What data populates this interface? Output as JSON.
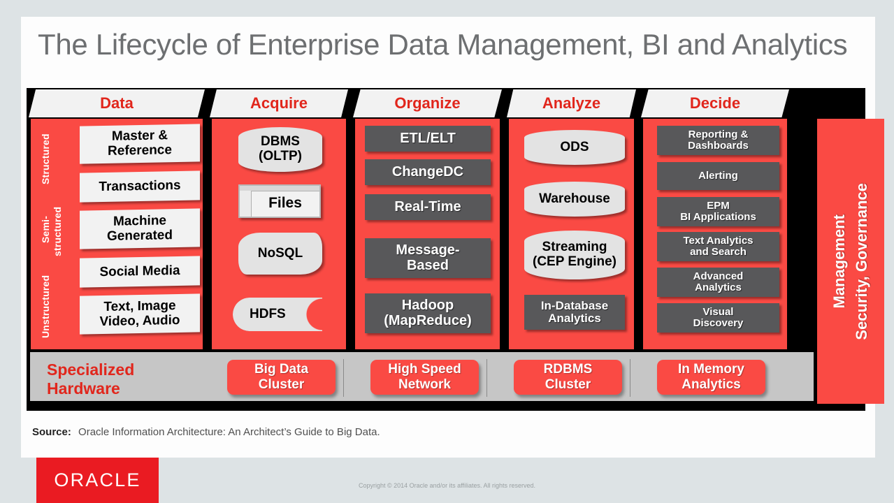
{
  "slide": {
    "title": "The Lifecycle of Enterprise Data Management, BI and Analytics",
    "source_label": "Source:",
    "source_text": "Oracle Information Architecture: An Architect’s Guide to Big Data.",
    "copyright": "Copyright © 2014 Oracle and/or its affiliates. All rights reserved.",
    "logo_text": "ORACLE"
  },
  "colors": {
    "red": "#fa4a44",
    "brand_red": "#e1261c",
    "dark_gray": "#58585a",
    "light_gray_node": "#e3e3e3",
    "white_node": "#f2f2f2",
    "hardware_band": "#c6c6c6",
    "frame": "#000000",
    "page_bg": "#dde3e5"
  },
  "columns": [
    {
      "header": "Data",
      "structure_labels": [
        "Structured",
        "Semi-\nstructured",
        "Unstructured"
      ],
      "structure_label_1": "Structured",
      "structure_label_2a": "Semi-",
      "structure_label_2b": "structured",
      "structure_label_3": "Unstructured",
      "nodes": [
        {
          "label": "Master &\nReference",
          "line1": "Master &",
          "line2": "Reference",
          "shape": "box-white"
        },
        {
          "label": "Transactions",
          "line1": "Transactions",
          "line2": "",
          "shape": "box-white"
        },
        {
          "label": "Machine\nGenerated",
          "line1": "Machine",
          "line2": "Generated",
          "shape": "box-white"
        },
        {
          "label": "Social Media",
          "line1": "Social Media",
          "line2": "",
          "shape": "box-white"
        },
        {
          "label": "Text, Image\nVideo, Audio",
          "line1": "Text, Image",
          "line2": "Video, Audio",
          "shape": "box-white"
        }
      ]
    },
    {
      "header": "Acquire",
      "nodes": [
        {
          "label": "DBMS\n(OLTP)",
          "line1": "DBMS",
          "line2": "(OLTP)",
          "shape": "cylinder"
        },
        {
          "label": "Files",
          "line1": "Files",
          "line2": "",
          "shape": "window"
        },
        {
          "label": "NoSQL",
          "line1": "NoSQL",
          "line2": "",
          "shape": "flowchart"
        },
        {
          "label": "HDFS",
          "line1": "HDFS",
          "line2": "",
          "shape": "tape"
        }
      ]
    },
    {
      "header": "Organize",
      "nodes": [
        {
          "label": "ETL/ELT",
          "line1": "ETL/ELT",
          "line2": "",
          "shape": "box-gray"
        },
        {
          "label": "ChangeDC",
          "line1": "ChangeDC",
          "line2": "",
          "shape": "box-gray"
        },
        {
          "label": "Real-Time",
          "line1": "Real-Time",
          "line2": "",
          "shape": "box-gray"
        },
        {
          "label": "Message-\nBased",
          "line1": "Message-",
          "line2": "Based",
          "shape": "box-gray"
        },
        {
          "label": "Hadoop\n(MapReduce)",
          "line1": "Hadoop",
          "line2": "(MapReduce)",
          "shape": "box-gray"
        }
      ]
    },
    {
      "header": "Analyze",
      "nodes": [
        {
          "label": "ODS",
          "line1": "ODS",
          "line2": "",
          "shape": "cylinder"
        },
        {
          "label": "Warehouse",
          "line1": "Warehouse",
          "line2": "",
          "shape": "cylinder"
        },
        {
          "label": "Streaming\n(CEP Engine)",
          "line1": "Streaming",
          "line2": "(CEP Engine)",
          "shape": "cylinder"
        },
        {
          "label": "In-Database\nAnalytics",
          "line1": "In-Database",
          "line2": "Analytics",
          "shape": "box-gray"
        }
      ]
    },
    {
      "header": "Decide",
      "nodes": [
        {
          "label": "Reporting &\nDashboards",
          "line1": "Reporting &",
          "line2": "Dashboards",
          "shape": "box-gray"
        },
        {
          "label": "Alerting",
          "line1": "Alerting",
          "line2": "",
          "shape": "box-gray"
        },
        {
          "label": "EPM\nBI Applications",
          "line1": "EPM",
          "line2": "BI Applications",
          "shape": "box-gray"
        },
        {
          "label": "Text Analytics\nand Search",
          "line1": "Text Analytics",
          "line2": "and Search",
          "shape": "box-gray"
        },
        {
          "label": "Advanced\nAnalytics",
          "line1": "Advanced",
          "line2": "Analytics",
          "shape": "box-gray"
        },
        {
          "label": "Visual\nDiscovery",
          "line1": "Visual",
          "line2": "Discovery",
          "shape": "box-gray"
        }
      ]
    }
  ],
  "governance": {
    "line1": "Management",
    "line2": "Security, Governance"
  },
  "hardware": {
    "label_line1": "Specialized",
    "label_line2": "Hardware",
    "items": [
      {
        "line1": "Big Data",
        "line2": "Cluster"
      },
      {
        "line1": "High Speed",
        "line2": "Network"
      },
      {
        "line1": "RDBMS",
        "line2": "Cluster"
      },
      {
        "line1": "In Memory",
        "line2": "Analytics"
      }
    ]
  }
}
